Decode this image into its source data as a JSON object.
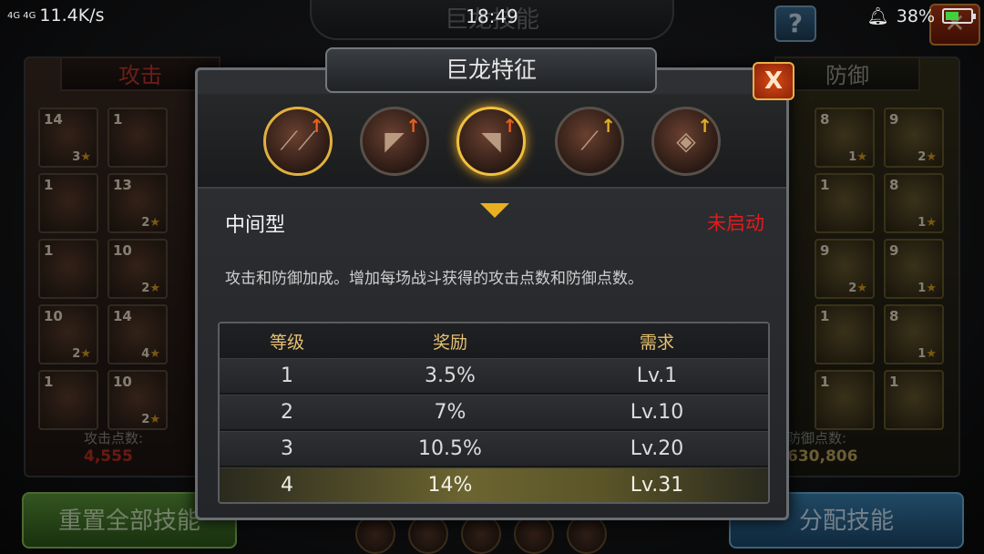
{
  "status_bar": {
    "network": "4G 4G",
    "speed": "11.4K/s",
    "time": "18:49",
    "battery": "38%"
  },
  "background": {
    "title": "巨龙技能",
    "attack_tab": "攻击",
    "defense_tab": "防御",
    "attack_points_label": "攻击点数:",
    "attack_points_value": "4,555",
    "defense_points_label": "防御点数:",
    "defense_points_value": "630,806",
    "reset_button": "重置全部技能",
    "assign_button": "分配技能",
    "attack_tiles": [
      {
        "n": "14",
        "s": "3"
      },
      {
        "n": "1",
        "s": ""
      },
      {
        "n": "1",
        "s": ""
      },
      {
        "n": "13",
        "s": "2"
      },
      {
        "n": "1",
        "s": ""
      },
      {
        "n": "10",
        "s": "2"
      },
      {
        "n": "10",
        "s": "2"
      },
      {
        "n": "14",
        "s": "4"
      },
      {
        "n": "1",
        "s": ""
      },
      {
        "n": "10",
        "s": "2"
      }
    ],
    "defense_tiles": [
      {
        "n": "8",
        "s": "1"
      },
      {
        "n": "9",
        "s": "2"
      },
      {
        "n": "1",
        "s": ""
      },
      {
        "n": "8",
        "s": "1"
      },
      {
        "n": "9",
        "s": "2"
      },
      {
        "n": "9",
        "s": "1"
      },
      {
        "n": "1",
        "s": ""
      },
      {
        "n": "8",
        "s": "1"
      },
      {
        "n": "1",
        "s": ""
      },
      {
        "n": "1",
        "s": ""
      }
    ]
  },
  "modal": {
    "title": "巨龙特征",
    "close": "X",
    "traits": [
      {
        "name": "claw-icon"
      },
      {
        "name": "dragon-head-icon"
      },
      {
        "name": "dragon-body-icon"
      },
      {
        "name": "horn-icon"
      },
      {
        "name": "scale-icon"
      }
    ],
    "selected_index": 2,
    "trait_name": "中间型",
    "trait_status": "未启动",
    "trait_description": "攻击和防御加成。增加每场战斗获得的攻击点数和防御点数。",
    "table": {
      "headers": [
        "等级",
        "奖励",
        "需求"
      ],
      "rows": [
        {
          "level": "1",
          "reward": "3.5%",
          "req": "Lv.1"
        },
        {
          "level": "2",
          "reward": "7%",
          "req": "Lv.10"
        },
        {
          "level": "3",
          "reward": "10.5%",
          "req": "Lv.20"
        },
        {
          "level": "4",
          "reward": "14%",
          "req": "Lv.31"
        }
      ]
    }
  },
  "colors": {
    "status_inactive": "#e01c1c",
    "header_gold": "#e6c070",
    "highlight_row": "#6c6430"
  }
}
